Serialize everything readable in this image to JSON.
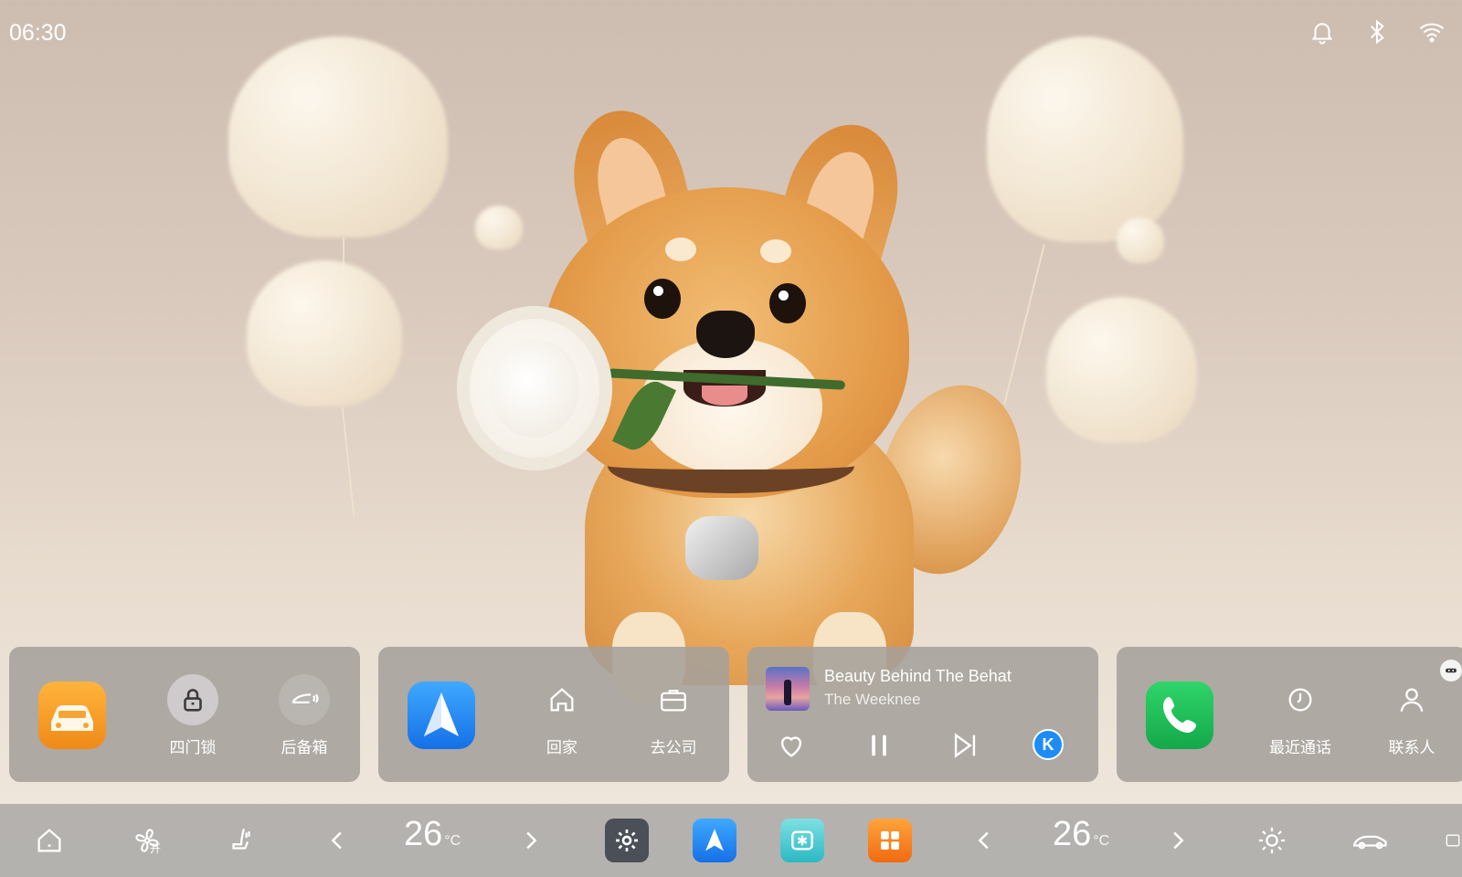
{
  "status_bar": {
    "time": "06:30",
    "icons": [
      "bell-icon",
      "bluetooth-icon",
      "wifi-icon"
    ]
  },
  "wallpaper": {
    "subject": "shiba-inu-with-white-rose-and-heart-balloons"
  },
  "vehicle_card": {
    "app_icon": "car-icon",
    "actions": [
      {
        "icon": "lock-icon",
        "label": "四门锁"
      },
      {
        "icon": "trunk-icon",
        "label": "后备箱"
      }
    ]
  },
  "navigation_card": {
    "app_icon": "navigation-arrow-icon",
    "actions": [
      {
        "icon": "home-icon",
        "label": "回家"
      },
      {
        "icon": "briefcase-icon",
        "label": "去公司"
      }
    ]
  },
  "music_card": {
    "title": "Beauty Behind The Behat",
    "artist": "The Weeknee",
    "source_badge": "K",
    "controls": [
      "heart-icon",
      "pause-icon",
      "next-track-icon"
    ]
  },
  "phone_card": {
    "app_icon": "phone-icon",
    "actions": [
      {
        "icon": "clock-icon",
        "label": "最近通话"
      },
      {
        "icon": "person-icon",
        "label": "联系人"
      }
    ]
  },
  "dock": {
    "left_temp": "26",
    "right_temp": "26",
    "temp_unit": "°C",
    "fan_state": "开",
    "apps": [
      "settings-icon",
      "navigation-app-icon",
      "climate-app-icon",
      "apps-grid-icon"
    ]
  },
  "colors": {
    "card_bg": "#a5a09b",
    "dock_bg": "#afacaa",
    "accent_blue": "#1e8cf5",
    "phone_green": "#14a84a",
    "car_orange": "#f08a18"
  }
}
